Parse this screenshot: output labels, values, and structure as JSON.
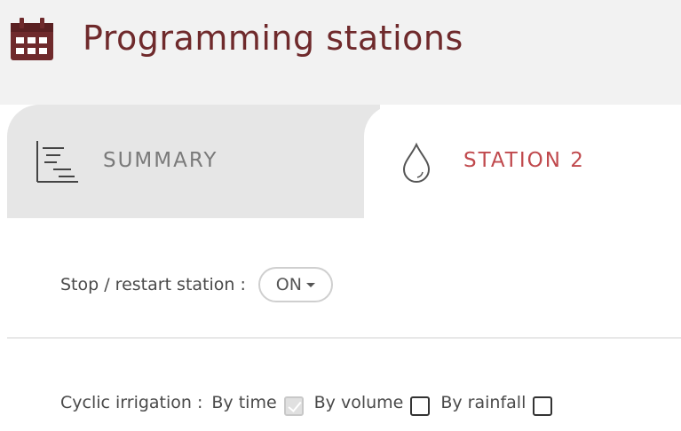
{
  "header": {
    "title": "Programming stations",
    "icon": "calendar-icon",
    "title_color": "#6f2a2c"
  },
  "tabs": [
    {
      "label": "SUMMARY",
      "icon": "gantt-chart-icon",
      "active": false
    },
    {
      "label": "STATION 2",
      "icon": "water-drop-icon",
      "active": true,
      "color": "#c0494d"
    }
  ],
  "station": {
    "stop_restart_label": "Stop / restart station :",
    "toggle_value": "ON",
    "cyclic_label": "Cyclic irrigation :",
    "options": [
      {
        "label": "By time",
        "checked": true,
        "disabled": true
      },
      {
        "label": "By volume",
        "checked": false,
        "disabled": false
      },
      {
        "label": "By rainfall",
        "checked": false,
        "disabled": false
      }
    ]
  }
}
